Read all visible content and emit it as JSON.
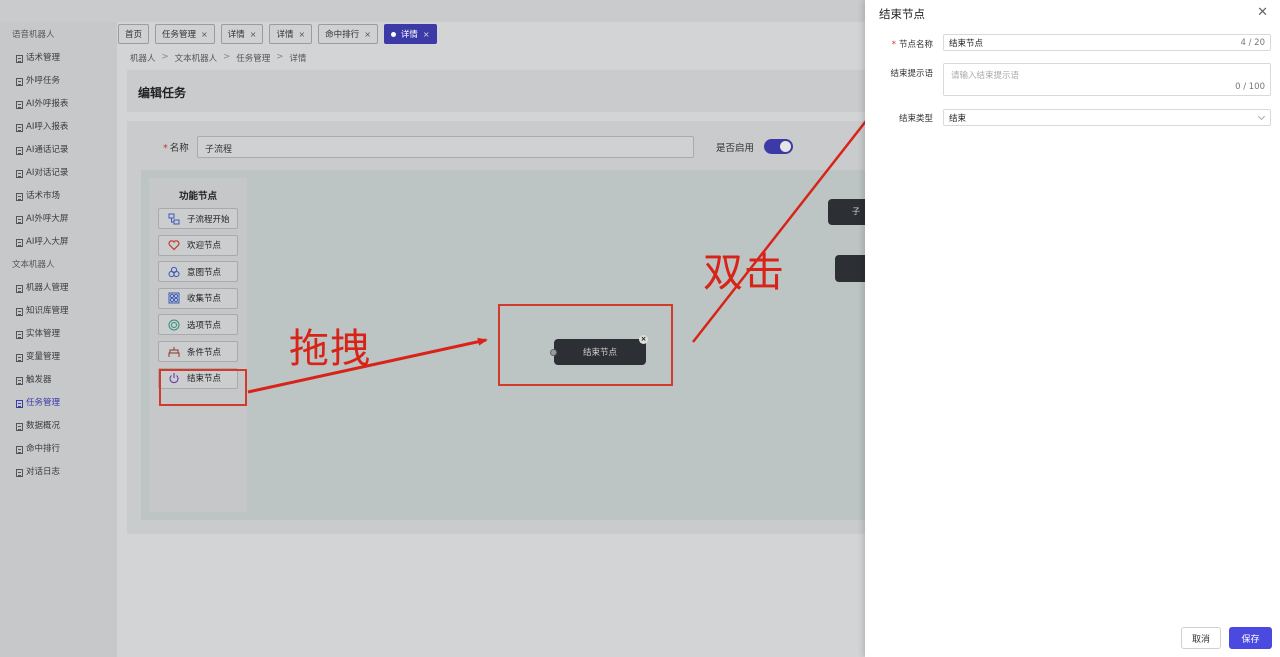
{
  "sidebar": {
    "groups": [
      {
        "label": "语音机器人",
        "items": [
          "话术管理",
          "外呼任务",
          "AI外呼报表",
          "AI呼入报表",
          "AI通话记录",
          "AI对话记录",
          "话术市场",
          "AI外呼大屏",
          "AI呼入大屏"
        ]
      },
      {
        "label": "文本机器人",
        "items": [
          "机器人管理",
          "知识库管理",
          "实体管理",
          "变量管理",
          "触发器",
          "任务管理",
          "数据概况",
          "命中排行",
          "对话日志"
        ]
      }
    ],
    "active_item": "任务管理"
  },
  "tabs": [
    {
      "label": "首页",
      "closable": false,
      "active": false
    },
    {
      "label": "任务管理",
      "closable": true,
      "active": false
    },
    {
      "label": "详情",
      "closable": true,
      "active": false
    },
    {
      "label": "详情",
      "closable": true,
      "active": false
    },
    {
      "label": "命中排行",
      "closable": true,
      "active": false
    },
    {
      "label": "详情",
      "closable": true,
      "active": true
    }
  ],
  "tab_close_glyph": "×",
  "breadcrumb": [
    "机器人",
    "文本机器人",
    "任务管理",
    "详情"
  ],
  "breadcrumb_sep": ">",
  "page_title": "编辑任务",
  "form": {
    "name_required_mark": "*",
    "name_label": "名称",
    "name_value": "子流程",
    "enable_label": "是否启用",
    "enabled": true
  },
  "palette": {
    "title": "功能节点",
    "items": [
      {
        "label": "子流程开始",
        "icon": "subflow-icon"
      },
      {
        "label": "欢迎节点",
        "icon": "heart-icon"
      },
      {
        "label": "意图节点",
        "icon": "intent-icon"
      },
      {
        "label": "收集节点",
        "icon": "collect-icon"
      },
      {
        "label": "选项节点",
        "icon": "target-icon"
      },
      {
        "label": "条件节点",
        "icon": "condition-icon"
      },
      {
        "label": "结束节点",
        "icon": "power-icon"
      }
    ]
  },
  "canvas": {
    "dropped_node_label": "结束节点",
    "background_node_label": "子流"
  },
  "annotations": {
    "drag_label": "拖拽",
    "dblclick_label": "双击",
    "color": "#d82418"
  },
  "drawer": {
    "title": "结束节点",
    "close_glyph": "✕",
    "node_name_required_mark": "*",
    "node_name_label": "节点名称",
    "node_name_value": "结束节点",
    "node_name_count": "4 / 20",
    "prompt_label": "结束提示语",
    "prompt_placeholder": "请输入结束提示语",
    "prompt_count": "0 / 100",
    "end_type_label": "结束类型",
    "end_type_value": "结束",
    "cancel_label": "取消",
    "save_label": "保存"
  },
  "colors": {
    "accent": "#4b4ae0",
    "annotation_red": "#d23a2c"
  }
}
